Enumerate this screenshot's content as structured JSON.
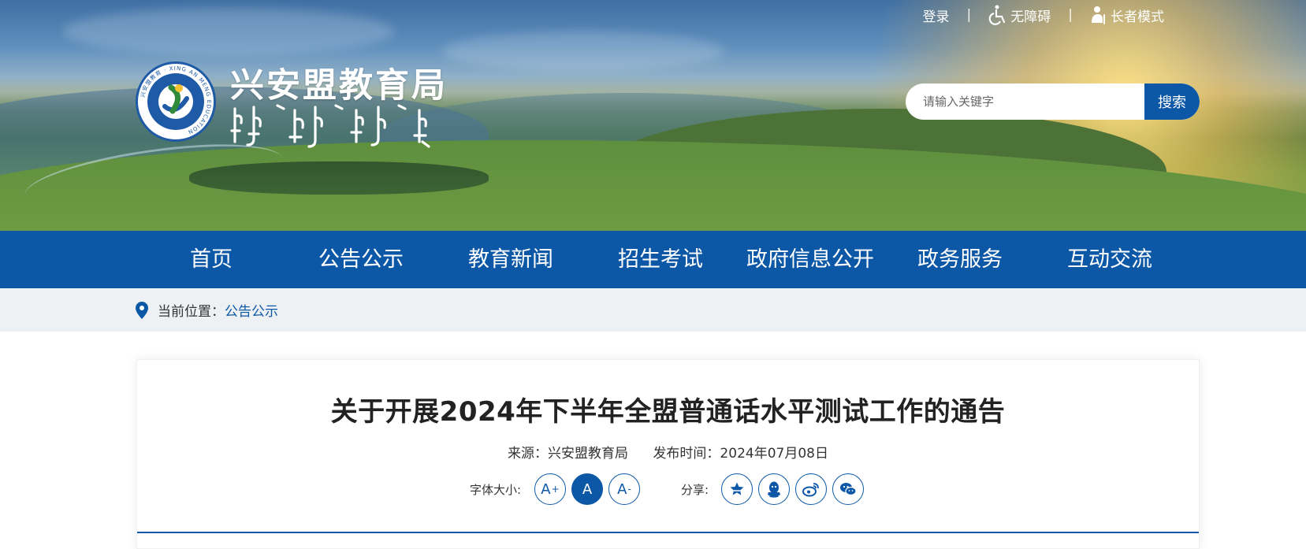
{
  "header": {
    "site_title": "兴安盟教育局",
    "logo_ring_text": "兴安盟教育 · XING AN MENG EDUCATION",
    "top_links": {
      "login": "登录",
      "accessibility": "无障碍",
      "elder_mode": "长者模式",
      "separator": "|"
    },
    "search": {
      "placeholder": "请输入关键字",
      "button": "搜索"
    }
  },
  "nav": {
    "items": [
      {
        "label": "首页"
      },
      {
        "label": "公告公示"
      },
      {
        "label": "教育新闻"
      },
      {
        "label": "招生考试"
      },
      {
        "label": "政府信息公开"
      },
      {
        "label": "政务服务"
      },
      {
        "label": "互动交流"
      }
    ]
  },
  "breadcrumb": {
    "prefix": "当前位置：",
    "current": "公告公示"
  },
  "article": {
    "title": "关于开展2024年下半年全盟普通话水平测试工作的通告",
    "source": "来源：兴安盟教育局",
    "publish_time": "发布时间：2024年07月08日",
    "font_size_label": "字体大小:",
    "font_buttons": {
      "increase": "A",
      "normal": "A",
      "decrease": "A",
      "plus": "+",
      "minus": "-"
    },
    "share_label": "分享:"
  },
  "icons": [
    "wheelchair-icon",
    "elder-icon",
    "location-pin-icon",
    "star-icon",
    "qq-icon",
    "weibo-icon",
    "wechat-icon"
  ],
  "colors": {
    "primary": "#0d58a6",
    "breadcrumb_bg": "#eef1f4",
    "title_text": "#222222"
  }
}
